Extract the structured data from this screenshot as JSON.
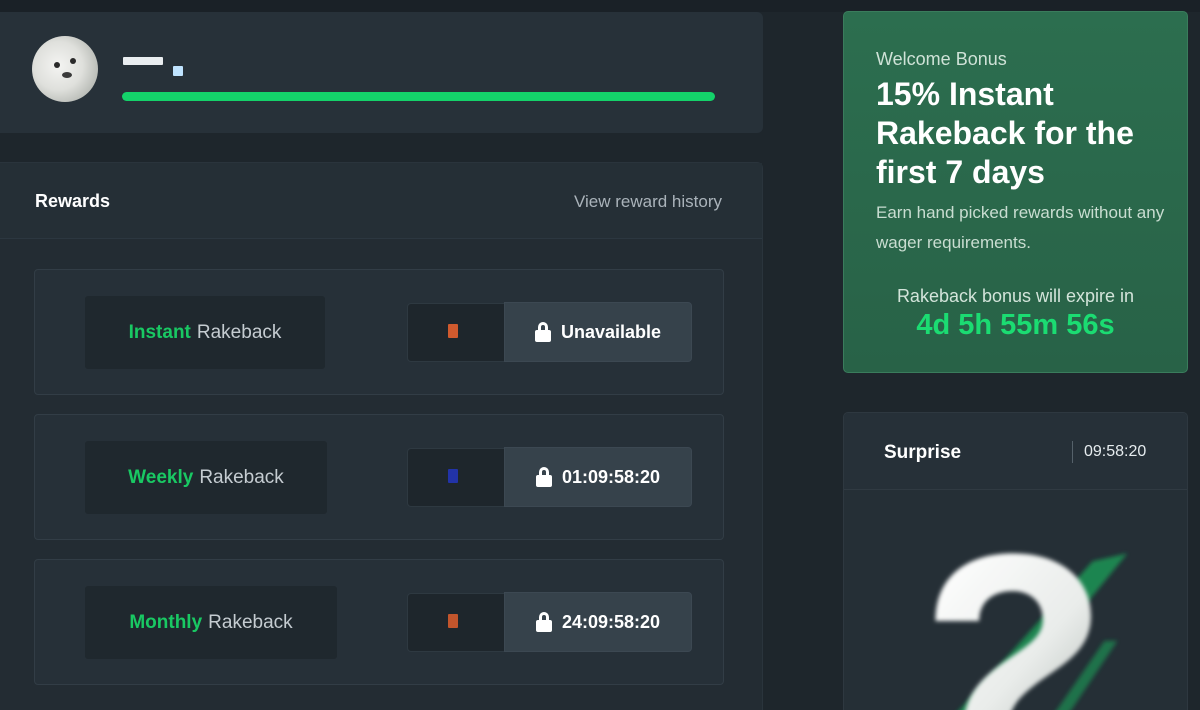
{
  "profile": {
    "username": "",
    "level_progress_percent": 100
  },
  "rewards": {
    "title": "Rewards",
    "history_link": "View reward history",
    "items": [
      {
        "accent": "Instant",
        "label": "Rakeback",
        "button_label": "Unavailable",
        "icon_color": "#d05a2e"
      },
      {
        "accent": "Weekly",
        "label": "Rakeback",
        "button_label": "01:09:58:20",
        "icon_color": "#2233a8"
      },
      {
        "accent": "Monthly",
        "label": "Rakeback",
        "button_label": "24:09:58:20",
        "icon_color": "#c2552c"
      }
    ]
  },
  "welcome_bonus": {
    "kicker": "Welcome Bonus",
    "title": "15% Instant Rakeback for the first 7 days",
    "description": "Earn hand picked rewards without any wager requirements.",
    "expire_label": "Rakeback bonus will expire in",
    "countdown": "4d 5h 55m 56s"
  },
  "surprise": {
    "title": "Surprise",
    "timer": "09:58:20"
  },
  "colors": {
    "accent_green": "#19c863",
    "bonus_bg": "#2c6e4f",
    "panel_bg": "#263038"
  }
}
